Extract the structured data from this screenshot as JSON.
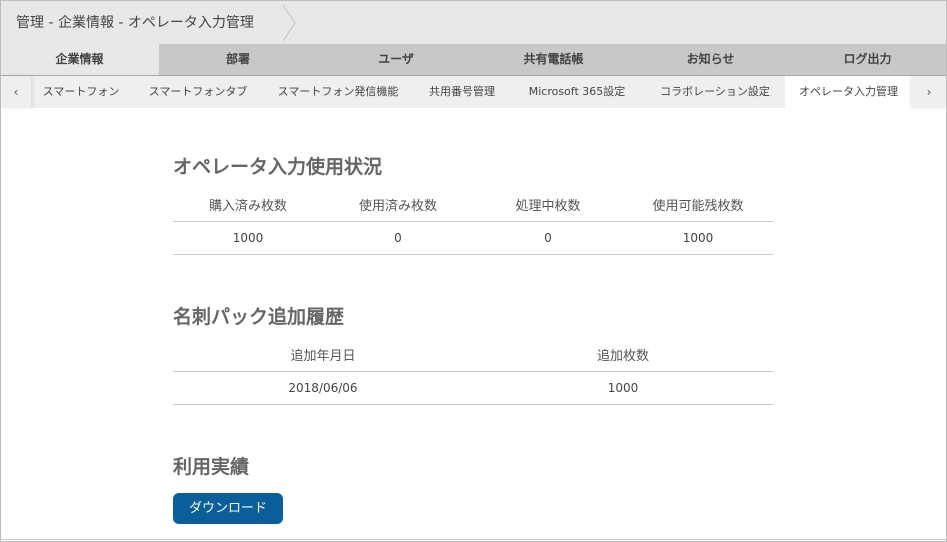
{
  "breadcrumb": "管理 - 企業情報 - オペレータ入力管理",
  "main_tabs": [
    {
      "label": "企業情報",
      "active": true
    },
    {
      "label": "部署",
      "active": false
    },
    {
      "label": "ユーザ",
      "active": false
    },
    {
      "label": "共有電話帳",
      "active": false
    },
    {
      "label": "お知らせ",
      "active": false
    },
    {
      "label": "ログ出力",
      "active": false
    }
  ],
  "sub_tabs": [
    {
      "label": "スマートフォン",
      "active": false
    },
    {
      "label": "スマートフォンタブ",
      "active": false
    },
    {
      "label": "スマートフォン発信機能",
      "active": false
    },
    {
      "label": "共用番号管理",
      "active": false
    },
    {
      "label": "Microsoft 365設定",
      "active": false
    },
    {
      "label": "コラボレーション設定",
      "active": false
    },
    {
      "label": "オペレータ入力管理",
      "active": true
    }
  ],
  "nav": {
    "prev": "‹",
    "next": "›"
  },
  "usage": {
    "title": "オペレータ入力使用状況",
    "headers": [
      "購入済み枚数",
      "使用済み枚数",
      "処理中枚数",
      "使用可能残枚数"
    ],
    "values": [
      "1000",
      "0",
      "0",
      "1000"
    ]
  },
  "history": {
    "title": "名刺パック追加履歴",
    "headers": [
      "追加年月日",
      "追加枚数"
    ],
    "rows": [
      [
        "2018/06/06",
        "1000"
      ]
    ]
  },
  "results": {
    "title": "利用実績",
    "download_label": "ダウンロード"
  },
  "colors": {
    "accent": "#0a5f9a"
  }
}
